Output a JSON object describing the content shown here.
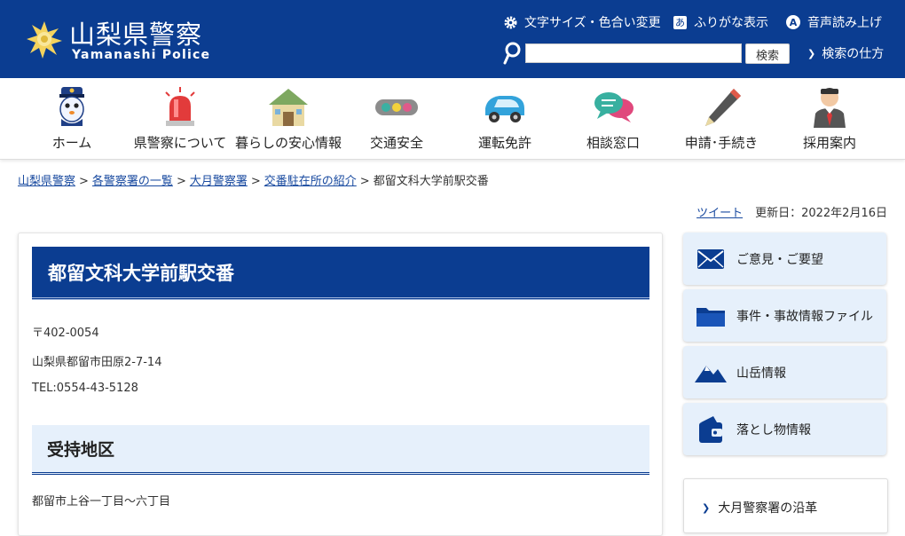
{
  "header": {
    "title": "山梨県警察",
    "subtitle": "Yamanashi Police",
    "utilities": {
      "font_color": "文字サイズ・色合い変更",
      "furigana": "ふりがな表示",
      "furigana_badge": "あ",
      "voice": "音声読み上げ",
      "voice_badge": "A"
    },
    "search": {
      "placeholder": "",
      "button": "検索",
      "help": "検索の仕方"
    },
    "colors": {
      "brand": "#0b3d91"
    }
  },
  "nav": {
    "items": [
      {
        "label": "ホーム",
        "icon": "police-mascot-icon"
      },
      {
        "label": "県警察について",
        "icon": "siren-icon"
      },
      {
        "label": "暮らしの安心情報",
        "icon": "house-icon"
      },
      {
        "label": "交通安全",
        "icon": "traffic-light-icon"
      },
      {
        "label": "運転免許",
        "icon": "car-icon"
      },
      {
        "label": "相談窓口",
        "icon": "chat-bubbles-icon"
      },
      {
        "label": "申請･手続き",
        "icon": "pen-icon"
      },
      {
        "label": "採用案内",
        "icon": "officer-icon"
      }
    ]
  },
  "breadcrumb": {
    "items": [
      "山梨県警察",
      "各警察署の一覧",
      "大月警察署",
      "交番駐在所の紹介"
    ],
    "current": "都留文科大学前駅交番",
    "separator": ">"
  },
  "meta": {
    "tweet": "ツイート",
    "updated": "更新日：2022年2月16日"
  },
  "main": {
    "title": "都留文科大学前駅交番",
    "postal": "〒402-0054",
    "address": "山梨県都留市田原2-7-14",
    "tel": "TEL:0554-43-5128",
    "section_title": "受持地区",
    "section_body": "都留市上谷一丁目〜六丁目"
  },
  "sidebar": {
    "buttons": [
      {
        "label": "ご意見・ご要望",
        "icon": "mail-icon"
      },
      {
        "label": "事件・事故情報ファイル",
        "icon": "folder-icon"
      },
      {
        "label": "山岳情報",
        "icon": "mountain-icon"
      },
      {
        "label": "落とし物情報",
        "icon": "wallet-icon"
      }
    ],
    "links": [
      {
        "label": "大月警察署の沿革"
      }
    ]
  }
}
